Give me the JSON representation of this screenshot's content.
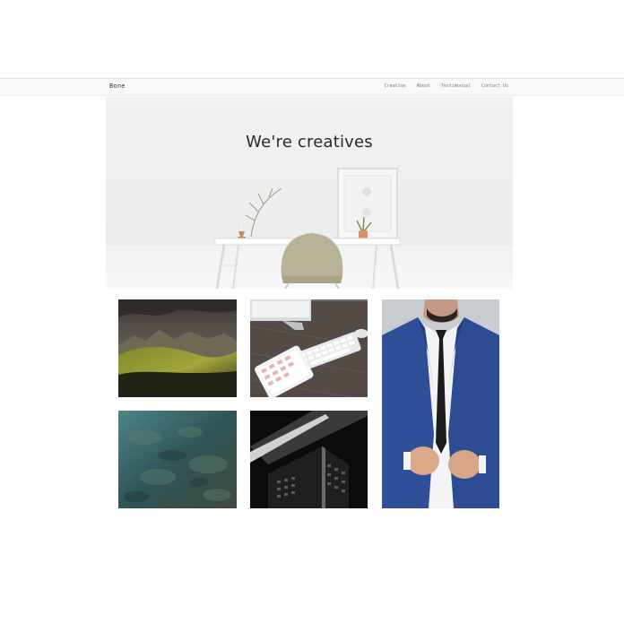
{
  "brand": {
    "name": "Bone"
  },
  "nav": {
    "items": [
      {
        "label": "Creative"
      },
      {
        "label": "About"
      },
      {
        "label": "Testimonial"
      },
      {
        "label": "Contact Us"
      }
    ]
  },
  "hero": {
    "title": "We're creatives"
  },
  "gallery": {
    "items": [
      {
        "icon": "mountain-landscape-photo"
      },
      {
        "icon": "desk-keyboard-photo"
      },
      {
        "icon": "man-in-suit-photo"
      },
      {
        "icon": "aerial-terrain-photo"
      },
      {
        "icon": "skyscraper-photo"
      }
    ]
  }
}
